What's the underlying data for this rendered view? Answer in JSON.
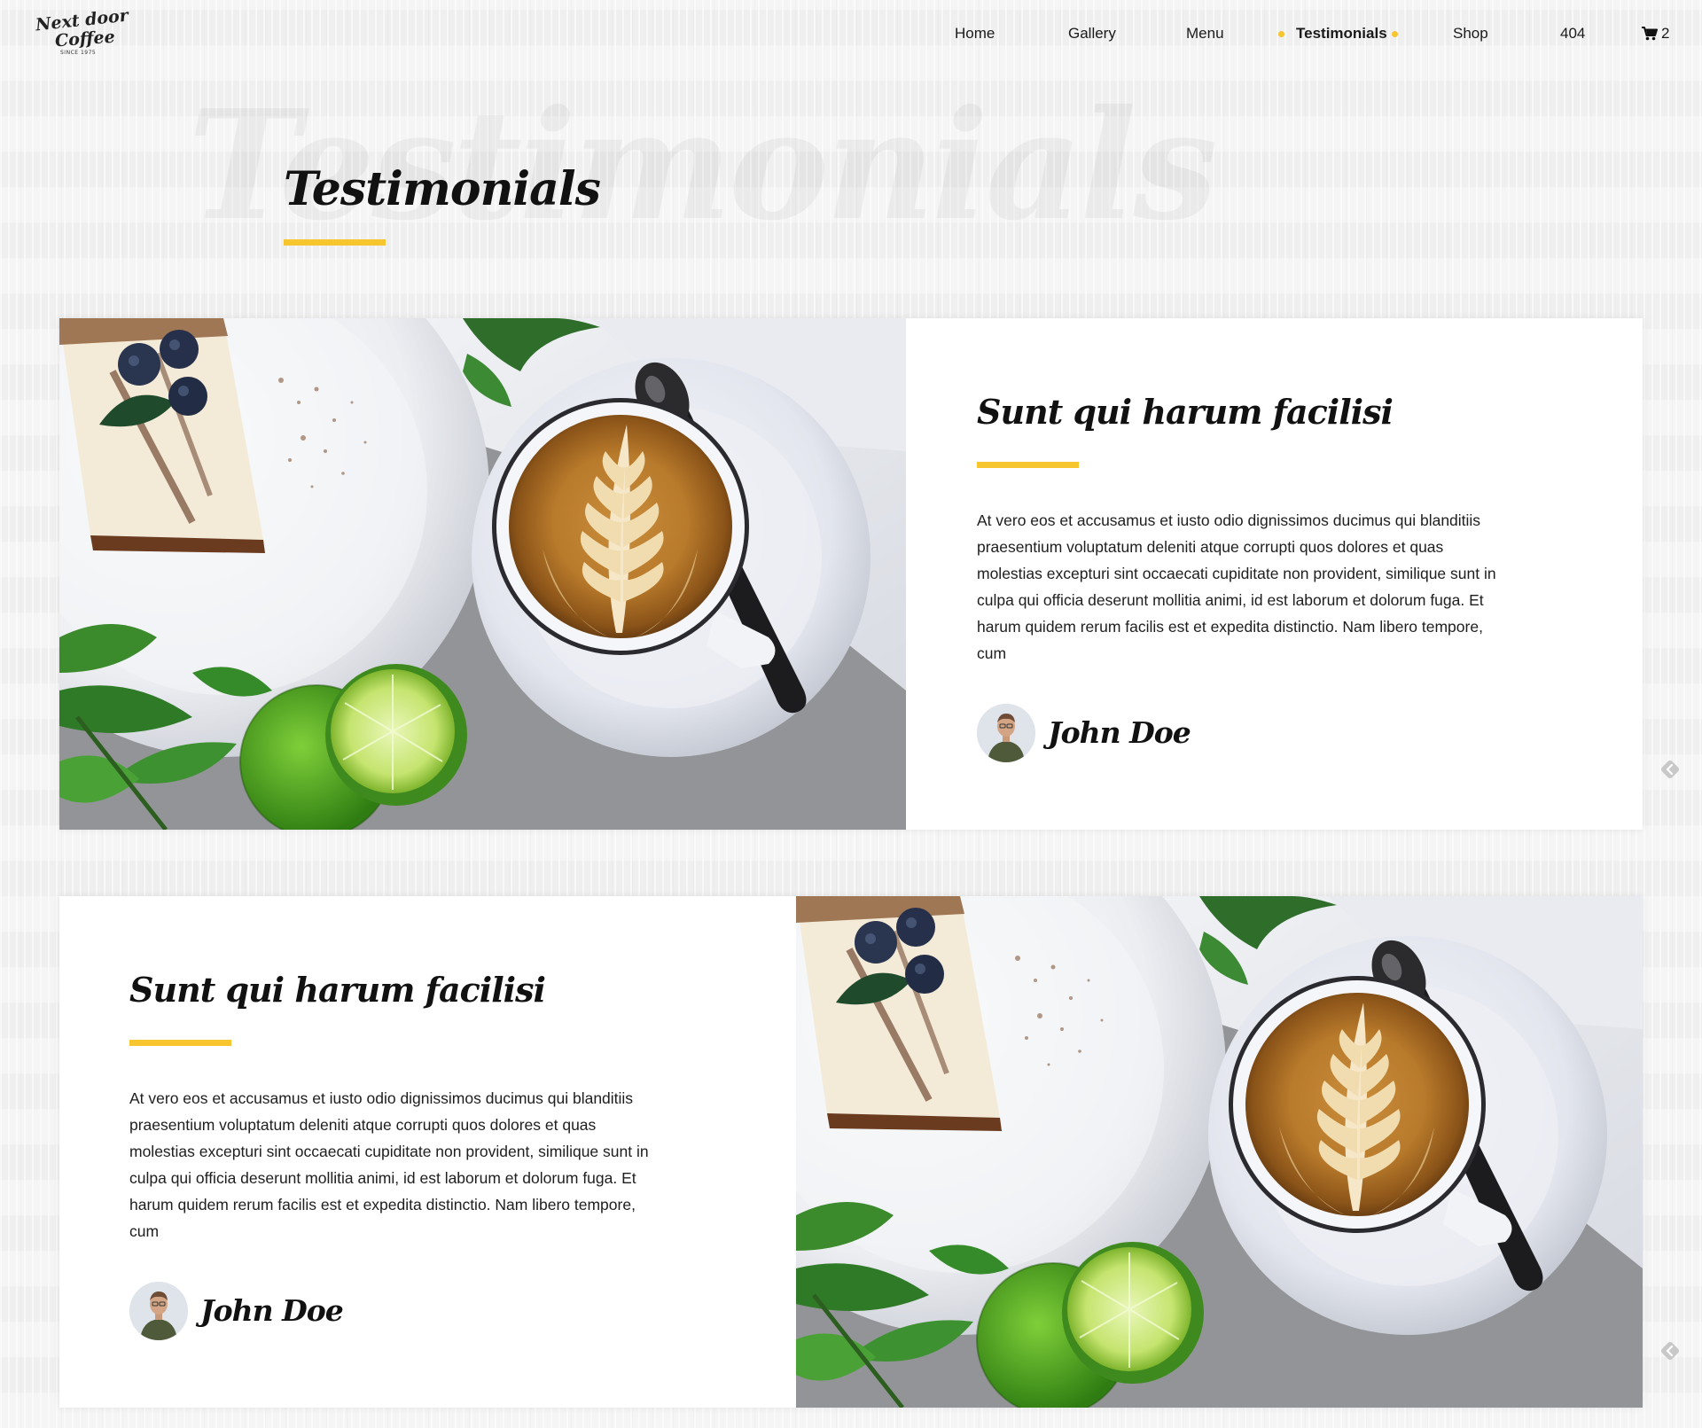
{
  "logo": {
    "line1": "Next door",
    "line2": "Coffee",
    "line3": "SINCE 1975"
  },
  "nav": {
    "items": [
      {
        "label": "Home",
        "active": false
      },
      {
        "label": "Gallery",
        "active": false
      },
      {
        "label": "Menu",
        "active": false
      },
      {
        "label": "Testimonials",
        "active": true
      },
      {
        "label": "Shop",
        "active": false
      },
      {
        "label": "404",
        "active": false
      }
    ],
    "cart_count": "2",
    "cart_icon": "cart-icon"
  },
  "hero": {
    "background_title": "Testimonials",
    "title": "Testimonials"
  },
  "testimonials": [
    {
      "title": "Sunt qui harum facilisi",
      "body": "At vero eos et accusamus et iusto odio dignissimos ducimus qui blanditiis praesentium voluptatum deleniti atque corrupti quos dolores et quas molestias excepturi sint occaecati cupiditate non provident, similique sunt in culpa qui officia deserunt mollitia animi, id est laborum et dolorum fuga. Et harum quidem rerum facilis est et expedita distinctio. Nam libero tempore, cum",
      "author": "John Doe",
      "image_position": "left"
    },
    {
      "title": "Sunt qui harum facilisi",
      "body": "At vero eos et accusamus et iusto odio dignissimos ducimus qui blanditiis praesentium voluptatum deleniti atque corrupti quos dolores et quas molestias excepturi sint occaecati cupiditate non provident, similique sunt in culpa qui officia deserunt mollitia animi, id est laborum et dolorum fuga. Et harum quidem rerum facilis est et expedita distinctio. Nam libero tempore, cum",
      "author": "John Doe",
      "image_position": "right"
    }
  ],
  "colors": {
    "accent": "#f7c52e",
    "text": "#1a1a1a",
    "card": "#ffffff"
  }
}
